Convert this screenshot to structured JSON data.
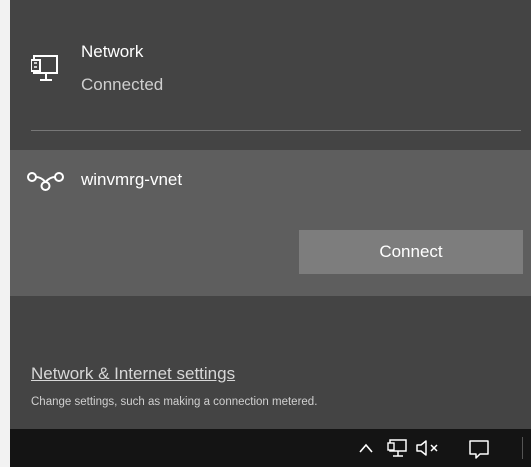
{
  "ethernet": {
    "title": "Network",
    "status": "Connected",
    "icon": "ethernet-monitor-icon"
  },
  "vpn": {
    "name": "winvmrg-vnet",
    "icon": "vpn-link-icon",
    "connect_label": "Connect"
  },
  "settings": {
    "link_label": "Network & Internet settings",
    "description": "Change settings, such as making a connection metered."
  },
  "taskbar": {
    "tray_icons": [
      "chevron-up-icon",
      "network-icon",
      "volume-muted-icon",
      "action-center-icon"
    ]
  },
  "colors": {
    "flyout_background": "#444444",
    "selected_item_background": "#5e5e5e",
    "button_background": "#7d7d7d",
    "taskbar_background": "#141414"
  }
}
